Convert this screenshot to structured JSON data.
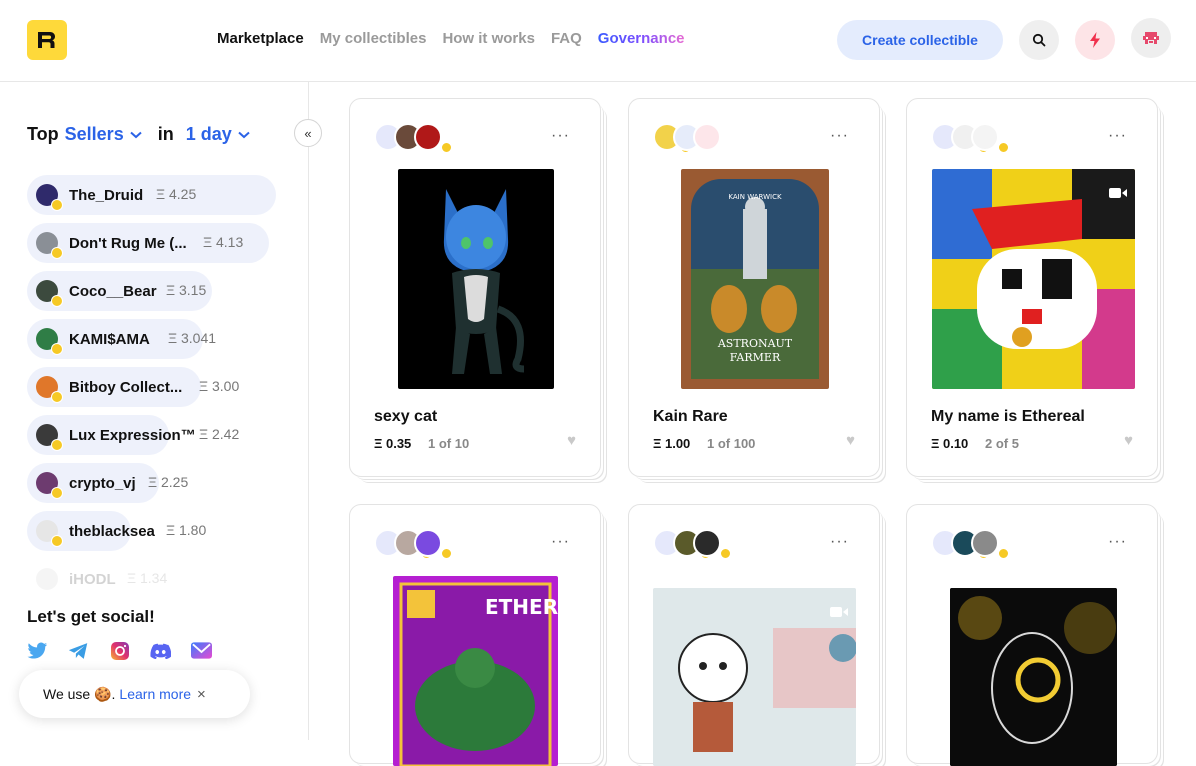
{
  "header": {
    "logo_alt": "R",
    "nav": [
      {
        "label": "Marketplace",
        "active": true
      },
      {
        "label": "My collectibles",
        "active": false
      },
      {
        "label": "How it works",
        "active": false
      },
      {
        "label": "FAQ",
        "active": false
      },
      {
        "label": "Governance",
        "active": false
      }
    ],
    "create_label": "Create collectible",
    "icons": [
      "search-icon",
      "bolt-icon",
      "user-avatar-icon"
    ]
  },
  "sidebar": {
    "top_label": "Top",
    "mode_label": "Sellers",
    "in_label": "in",
    "range_label": "1 day",
    "sellers": [
      {
        "name": "The_Druid",
        "amount": "Ξ 4.25",
        "color": "#2f2a6b"
      },
      {
        "name": "Don't Rug Me (...",
        "amount": "Ξ 4.13",
        "color": "#8a8f96"
      },
      {
        "name": "Coco__Bear",
        "amount": "Ξ 3.15",
        "color": "#3c4a3e"
      },
      {
        "name": "KAMI$AMA",
        "amount": "Ξ 3.041",
        "color": "#2f7d46"
      },
      {
        "name": "Bitboy Collect...",
        "amount": "Ξ 3.00",
        "color": "#e0772a"
      },
      {
        "name": "Lux Expression™",
        "amount": "Ξ 2.42",
        "color": "#3a3a3a"
      },
      {
        "name": "crypto_vj",
        "amount": "Ξ 2.25",
        "color": "#6d3b6f"
      },
      {
        "name": "theblacksea",
        "amount": "Ξ 1.80",
        "color": "#e6e6e6"
      },
      {
        "name": "iHODL",
        "amount": "Ξ 1.34",
        "color": "#cccccc"
      }
    ],
    "social_title": "Let's get social!",
    "social": [
      "twitter-icon",
      "telegram-icon",
      "instagram-icon",
      "discord-icon",
      "email-icon"
    ],
    "cookie": {
      "text": "We use 🍪.",
      "link": "Learn more",
      "close": "×"
    }
  },
  "cards": [
    {
      "title": "sexy cat",
      "price": "Ξ 0.35",
      "edition": "1 of 10"
    },
    {
      "title": "Kain Rare",
      "price": "Ξ 1.00",
      "edition": "1 of 100"
    },
    {
      "title": "My name is Ethereal",
      "price": "Ξ 0.10",
      "edition": "2 of 5"
    },
    {
      "title": "",
      "price": "",
      "edition": ""
    },
    {
      "title": "",
      "price": "",
      "edition": ""
    },
    {
      "title": "",
      "price": "",
      "edition": ""
    }
  ],
  "art_text": {
    "kain_header": "KAIN WARWICK",
    "kain_footer_1": "ASTRONAUT",
    "kain_footer_2": "FARMER",
    "ether_label": "ETHER"
  },
  "more_label": "···"
}
